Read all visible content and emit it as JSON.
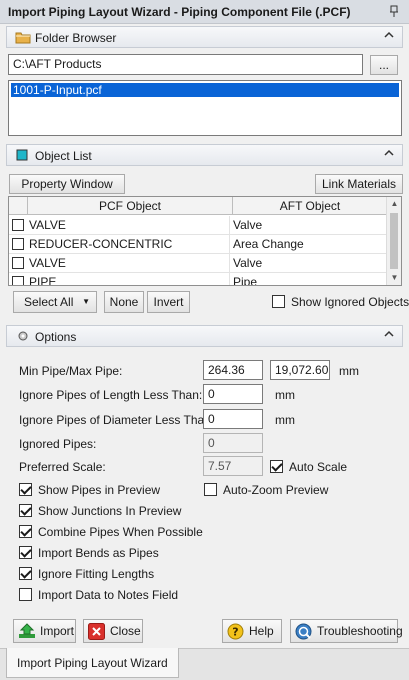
{
  "window": {
    "title": "Import Piping Layout Wizard - Piping Component File (.PCF)",
    "pin_icon": "pin-icon"
  },
  "folder_browser": {
    "header": "Folder Browser",
    "path": "C:\\AFT Products",
    "browse_label": "...",
    "files": [
      "1001-P-Input.pcf"
    ]
  },
  "object_list": {
    "header": "Object List",
    "property_window_label": "Property Window",
    "link_materials_label": "Link Materials",
    "columns": [
      "PCF Object",
      "AFT Object"
    ],
    "rows": [
      {
        "pcf": "VALVE",
        "aft": "Valve",
        "checked": false
      },
      {
        "pcf": "REDUCER-CONCENTRIC",
        "aft": "Area Change",
        "checked": false
      },
      {
        "pcf": "VALVE",
        "aft": "Valve",
        "checked": false
      },
      {
        "pcf": "PIPE",
        "aft": "Pipe",
        "checked": false
      }
    ],
    "select_all_label": "Select All",
    "none_label": "None",
    "invert_label": "Invert",
    "show_ignored_label": "Show Ignored Objects",
    "show_ignored_checked": false
  },
  "options": {
    "header": "Options",
    "min_max_label": "Min Pipe/Max Pipe:",
    "min_pipe": "264.36",
    "max_pipe": "19,072.60",
    "unit_mm_1": "mm",
    "ignore_length_label": "Ignore Pipes of Length Less Than:",
    "ignore_length_value": "0",
    "unit_mm_2": "mm",
    "ignore_diameter_label": "Ignore Pipes of Diameter Less Than:",
    "ignore_diameter_value": "0",
    "unit_mm_3": "mm",
    "ignored_pipes_label": "Ignored Pipes:",
    "ignored_pipes_value": "0",
    "preferred_scale_label": "Preferred Scale:",
    "preferred_scale_value": "7.57",
    "auto_scale_label": "Auto Scale",
    "auto_scale_checked": true,
    "auto_zoom_label": "Auto-Zoom Preview",
    "auto_zoom_checked": false,
    "checkboxes": [
      {
        "label": "Show Pipes in Preview",
        "checked": true
      },
      {
        "label": "Show Junctions In Preview",
        "checked": true
      },
      {
        "label": "Combine Pipes When Possible",
        "checked": true
      },
      {
        "label": "Import Bends as Pipes",
        "checked": true
      },
      {
        "label": "Ignore Fitting Lengths",
        "checked": true
      },
      {
        "label": "Import Data to Notes Field",
        "checked": false
      }
    ]
  },
  "footer": {
    "import_label": "Import",
    "close_label": "Close",
    "help_label": "Help",
    "troubleshooting_label": "Troubleshooting"
  },
  "tab": {
    "label": "Import Piping Layout Wizard"
  },
  "colors": {
    "selection": "#0a64d6",
    "accent_teal": "#1fb6c9",
    "folder": "#e8b14a"
  }
}
